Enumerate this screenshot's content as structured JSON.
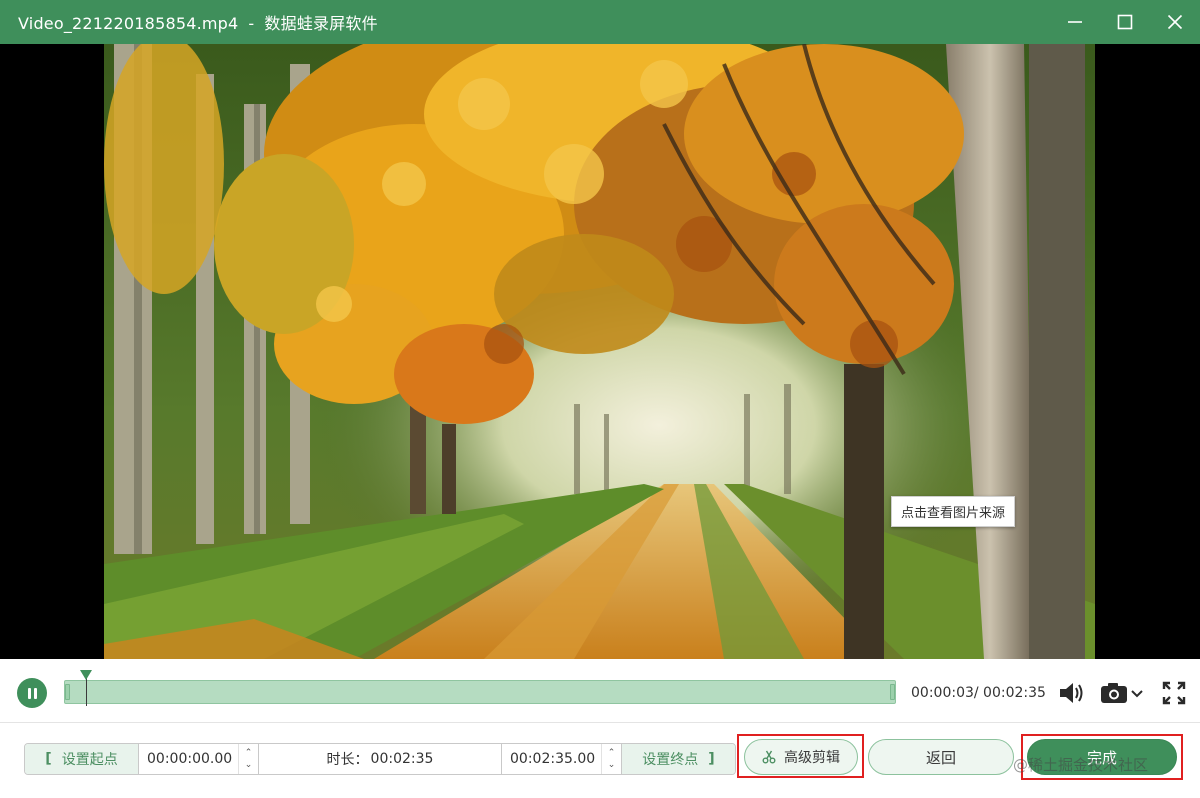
{
  "window": {
    "filename": "Video_221220185854.mp4",
    "separator": "-",
    "app_name": "数据蛙录屏软件"
  },
  "video": {
    "tooltip": "点击查看图片来源"
  },
  "playback": {
    "time_display": "00:00:03/ 00:02:35",
    "progress_fraction": 0.026
  },
  "range": {
    "set_start_label": "设置起点",
    "start_time": "00:00:00.00",
    "duration_label": "时长：",
    "duration_value": "00:02:35",
    "end_time": "00:02:35.00",
    "set_end_label": "设置终点",
    "bracket_left": "[",
    "bracket_right": "]",
    "spin_up": "⌃",
    "spin_down": "⌄"
  },
  "actions": {
    "advanced_edit": "高级剪辑",
    "back": "返回",
    "done": "完成"
  },
  "watermark": "@稀土掘金技术社区",
  "colors": {
    "accent": "#3f8f5b",
    "track": "#b5dcc1",
    "highlight": "#e02020"
  }
}
